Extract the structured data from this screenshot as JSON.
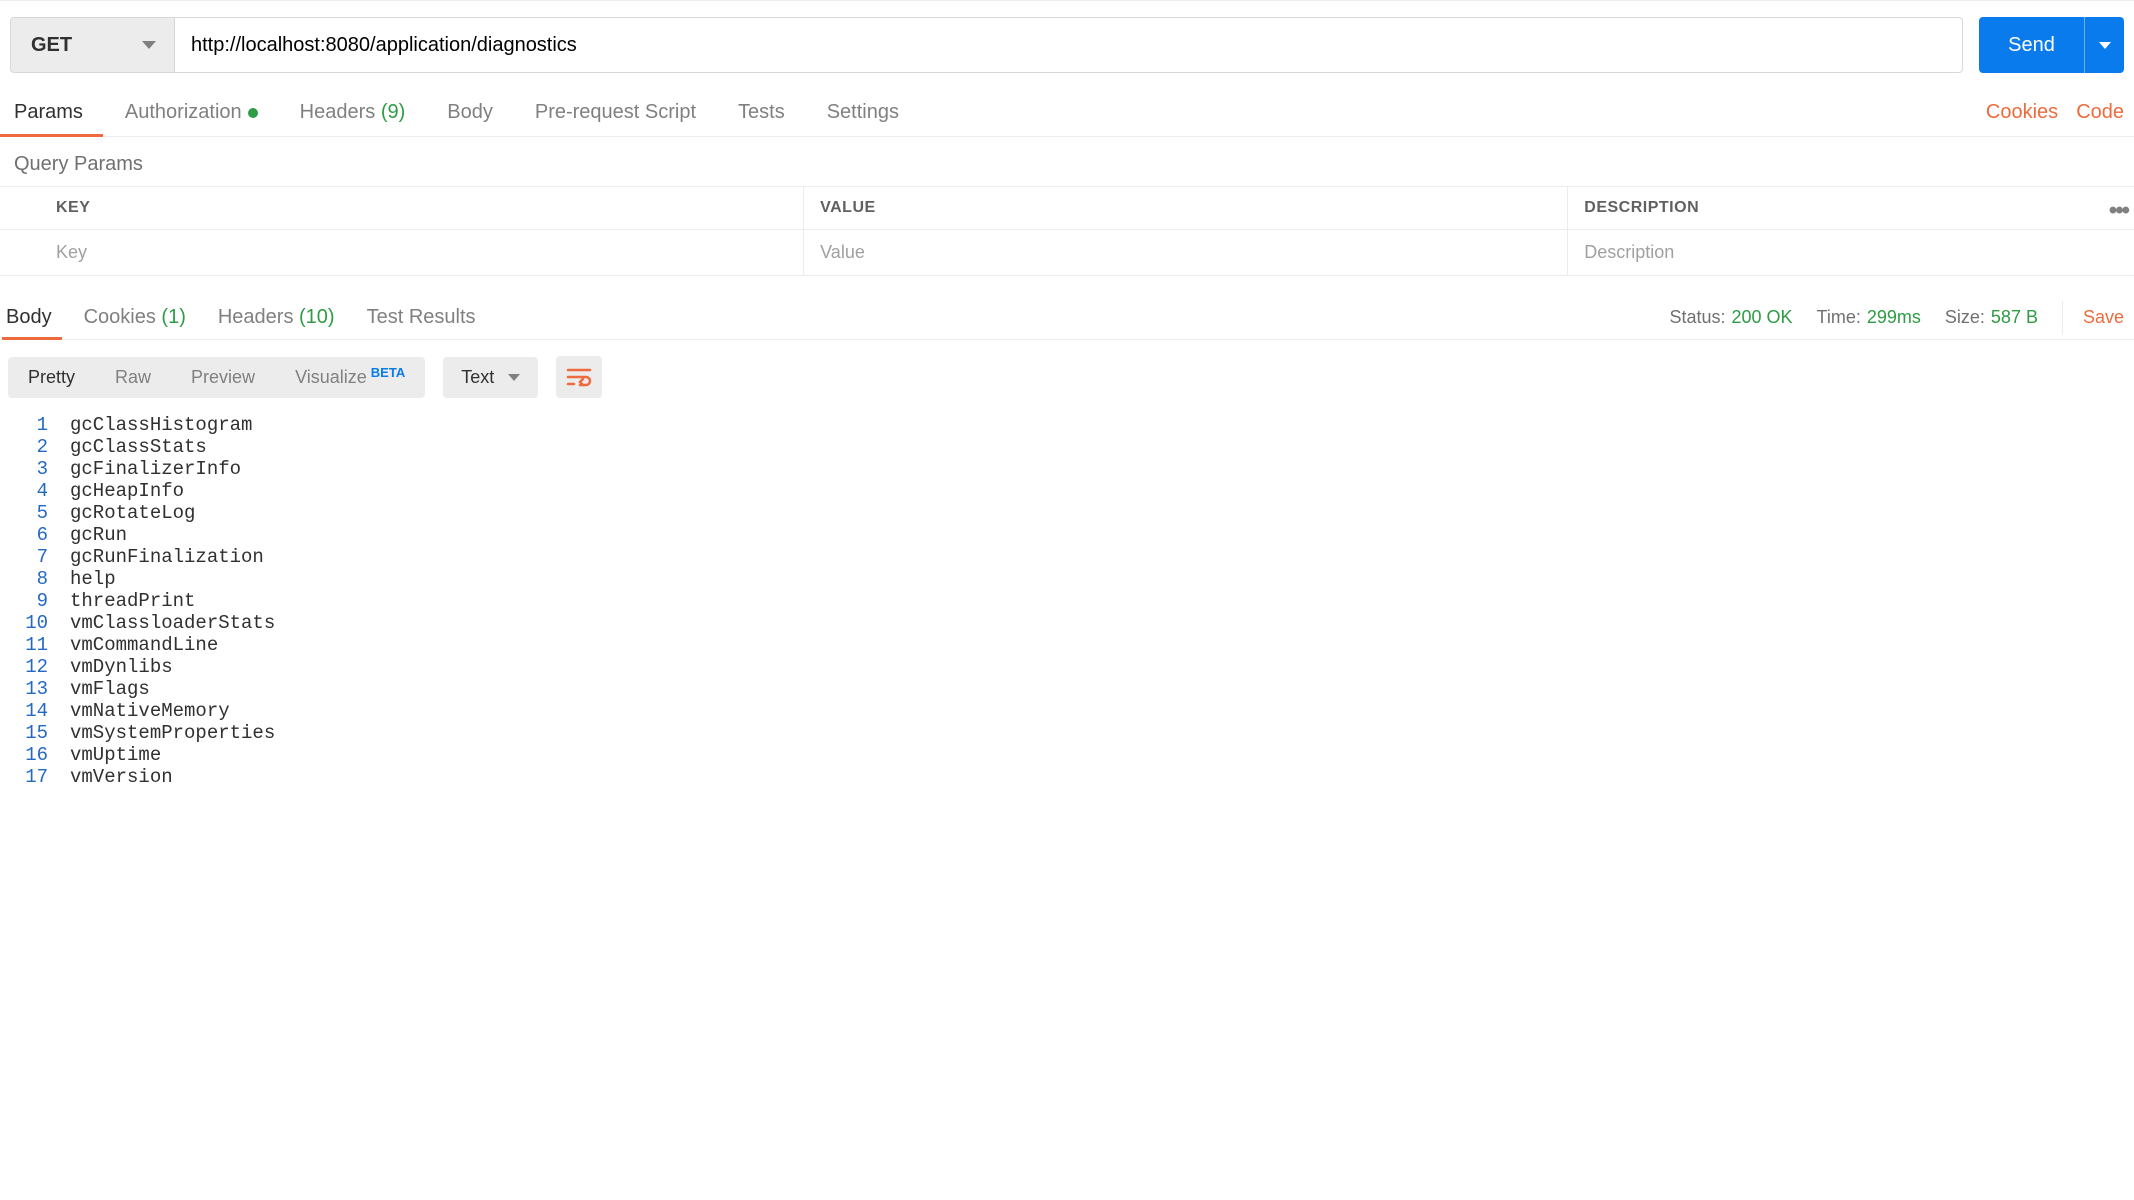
{
  "request": {
    "method": "GET",
    "url": "http://localhost:8080/application/diagnostics",
    "send_label": "Send"
  },
  "req_tabs": [
    {
      "label": "Params",
      "active": true
    },
    {
      "label": "Authorization",
      "dot": true
    },
    {
      "label": "Headers",
      "count": "(9)"
    },
    {
      "label": "Body"
    },
    {
      "label": "Pre-request Script"
    },
    {
      "label": "Tests"
    },
    {
      "label": "Settings"
    }
  ],
  "right_links": {
    "cookies": "Cookies",
    "code": "Code"
  },
  "query_params": {
    "title": "Query Params",
    "headers": {
      "key": "KEY",
      "value": "VALUE",
      "description": "DESCRIPTION"
    },
    "placeholders": {
      "key": "Key",
      "value": "Value",
      "description": "Description"
    }
  },
  "resp_tabs": [
    {
      "label": "Body",
      "active": true
    },
    {
      "label": "Cookies",
      "count": "(1)"
    },
    {
      "label": "Headers",
      "count": "(10)"
    },
    {
      "label": "Test Results"
    }
  ],
  "resp_meta": {
    "status_lbl": "Status:",
    "status_val": "200 OK",
    "time_lbl": "Time:",
    "time_val": "299ms",
    "size_lbl": "Size:",
    "size_val": "587 B",
    "save": "Save"
  },
  "body_view": {
    "modes": [
      {
        "label": "Pretty",
        "active": true
      },
      {
        "label": "Raw"
      },
      {
        "label": "Preview"
      },
      {
        "label": "Visualize",
        "beta": "BETA"
      }
    ],
    "format": "Text"
  },
  "body_lines": [
    "gcClassHistogram",
    "gcClassStats",
    "gcFinalizerInfo",
    "gcHeapInfo",
    "gcRotateLog",
    "gcRun",
    "gcRunFinalization",
    "help",
    "threadPrint",
    "vmClassloaderStats",
    "vmCommandLine",
    "vmDynlibs",
    "vmFlags",
    "vmNativeMemory",
    "vmSystemProperties",
    "vmUptime",
    "vmVersion"
  ]
}
